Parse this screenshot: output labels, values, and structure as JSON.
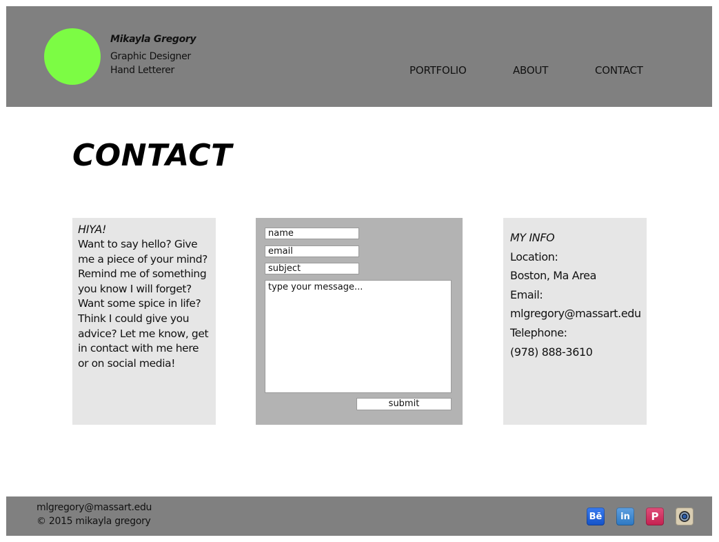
{
  "header": {
    "name": "Mikayla Gregory",
    "role_line1": "Graphic Designer",
    "role_line2": "Hand Letterer",
    "logo_color": "#7cfc44",
    "nav": [
      {
        "label": "PORTFOLIO"
      },
      {
        "label": "ABOUT"
      },
      {
        "label": "CONTACT"
      }
    ]
  },
  "page": {
    "title": "CONTACT"
  },
  "intro": {
    "greeting": "HIYA!",
    "message": "Want to say hello? Give me a piece of your mind? Remind me of something you know I will forget? Want some spice in life? Think I could give you advice? Let me know, get in contact with me here or on social media!"
  },
  "form": {
    "name_placeholder": "name",
    "email_placeholder": "email",
    "subject_placeholder": "subject",
    "message_placeholder": "type your message...",
    "submit_label": "submit"
  },
  "info": {
    "title": "MY INFO",
    "location_label": "Location:",
    "location_value": "Boston, Ma Area",
    "email_label": "Email:",
    "email_value": "mlgregory@massart.edu",
    "phone_label": "Telephone:",
    "phone_value": "(978) 888-3610"
  },
  "footer": {
    "email": "mlgregory@massart.edu",
    "copyright": "© 2015 mikayla gregory",
    "social": [
      {
        "icon": "behance-icon",
        "glyph": "Bē"
      },
      {
        "icon": "linkedin-icon",
        "glyph": "in"
      },
      {
        "icon": "pinterest-icon",
        "glyph": "P"
      },
      {
        "icon": "instagram-icon",
        "glyph": ""
      }
    ]
  }
}
